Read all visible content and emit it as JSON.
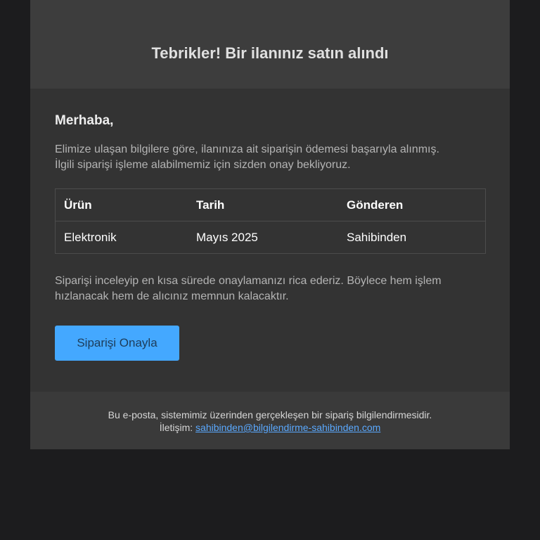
{
  "header": {
    "title": "Tebrikler! Bir ilanınız satın alındı"
  },
  "body": {
    "greeting": "Merhaba,",
    "intro_line1": "Elimize ulaşan bilgilere göre, ilanınıza ait siparişin ödemesi başarıyla alınmış.",
    "intro_line2": "İlgili siparişi işleme alabilmemiz için sizden onay bekliyoruz.",
    "table": {
      "headers": [
        "Ürün",
        "Tarih",
        "Gönderen"
      ],
      "rows": [
        [
          "Elektronik",
          "Mayıs 2025",
          "Sahibinden"
        ]
      ]
    },
    "request_line1": "Siparişi inceleyip en kısa sürede onaylamanızı rica ederiz. Böylece hem işlem",
    "request_line2": "hızlanacak hem de alıcınız memnun kalacaktır.",
    "confirm_button": "Siparişi Onayla"
  },
  "footer": {
    "line1": "Bu e-posta, sistemimiz üzerinden gerçekleşen bir sipariş bilgilendirmesidir.",
    "contact_label": "İletişim:",
    "contact_email": "sahibinden@bilgilendirme-sahibinden.com"
  },
  "colors": {
    "background": "#1c1c1e",
    "card": "#333333",
    "header": "#3d3d3d",
    "button": "#44a8ff",
    "link": "#5aa9ff"
  }
}
